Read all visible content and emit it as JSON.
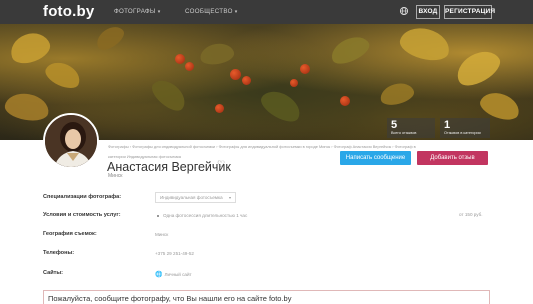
{
  "header": {
    "logo": "foto.by",
    "nav": [
      {
        "label": "ФОТОГРАФЫ"
      },
      {
        "label": "СООБЩЕСТВО"
      }
    ],
    "login_label": "ВХОД",
    "register_label": "РЕГИСТРАЦИЯ"
  },
  "profile": {
    "stats": [
      {
        "value": "5",
        "label": "Всего отзывов"
      },
      {
        "value": "1",
        "label": "Отзывов в категории"
      }
    ],
    "breadcrumbs": "Фотографы › Фотографы для индивидуальной фотосъемки › Фотографы для индивидуальной фотосъемки в городе Минск › Фотограф Анастасия Вергейчик › Фотограф в категории Индивидуальная фотосъемка",
    "name": "Анастасия Вергейчик",
    "city": "Минск",
    "message_button": "Написать сообщение",
    "review_button": "Добавить отзыв"
  },
  "details": {
    "specialization_label": "Специализации фотографа:",
    "specialization_value": "Индивидуальная фотосъемка",
    "conditions_label": "Условия и стоимость услуг:",
    "conditions_item": "Одна фотосессия длительностью 1 час",
    "conditions_price": "от 150 руб.",
    "geography_label": "География съемок:",
    "geography_value": "Минск",
    "phones_label": "Телефоны:",
    "phone_value": "+375 29 251-49-52",
    "sites_label": "Сайты:",
    "site_value": "Личный сайт"
  },
  "notice": "Пожалуйста, сообщите фотографу, что Вы нашли его на сайте foto.by"
}
